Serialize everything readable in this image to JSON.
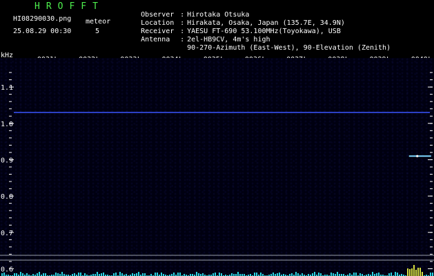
{
  "app": {
    "title": "HROFFT",
    "file_name": "HI08290030.png",
    "timestamp": "25.08.29 00:30",
    "meteor_label": "meteor",
    "meteor_count": "5"
  },
  "info": [
    {
      "label": "Observer",
      "sep": ":",
      "value": "Hirotaka Otsuka"
    },
    {
      "label": "Location",
      "sep": ":",
      "value": "Hirakata, Osaka, Japan (135.7E, 34.9N)"
    },
    {
      "label": "Receiver",
      "sep": ":",
      "value": "YAESU FT-690 53.100MHz(Toyokawa), USB"
    },
    {
      "label": "Antenna",
      "sep": ":",
      "value": "2el-HB9CV, 4m's high"
    },
    {
      "label": "",
      "sep": "",
      "value": "90-270-Azimuth (East-West), 90-Elevation (Zenith)"
    }
  ],
  "spectrogram": {
    "unit_label": "kHz",
    "time_ticks": [
      "0031",
      "0032",
      "0033",
      "0034",
      "0035",
      "0036",
      "0037",
      "0038",
      "0039",
      "0040"
    ],
    "freq_ticks": [
      {
        "value": 1.1,
        "label": "1.1"
      },
      {
        "value": 1.0,
        "label": "1.0"
      },
      {
        "value": 0.9,
        "label": "0.9"
      },
      {
        "value": 0.8,
        "label": "0.8"
      },
      {
        "value": 0.7,
        "label": "0.7"
      },
      {
        "value": 0.6,
        "label": "0.6"
      }
    ],
    "freq_range": [
      0.58,
      1.18
    ],
    "carrier_khz": 1.03,
    "echo": {
      "time_minutes": 9.65,
      "freq_khz": 0.91
    },
    "colors": {
      "background": "#000010",
      "carrier": "#3a55ff",
      "echo": "#7fd8ff",
      "axis": "#ffffff",
      "title": "#4ef04e",
      "meter": "#2ad4e0"
    }
  }
}
